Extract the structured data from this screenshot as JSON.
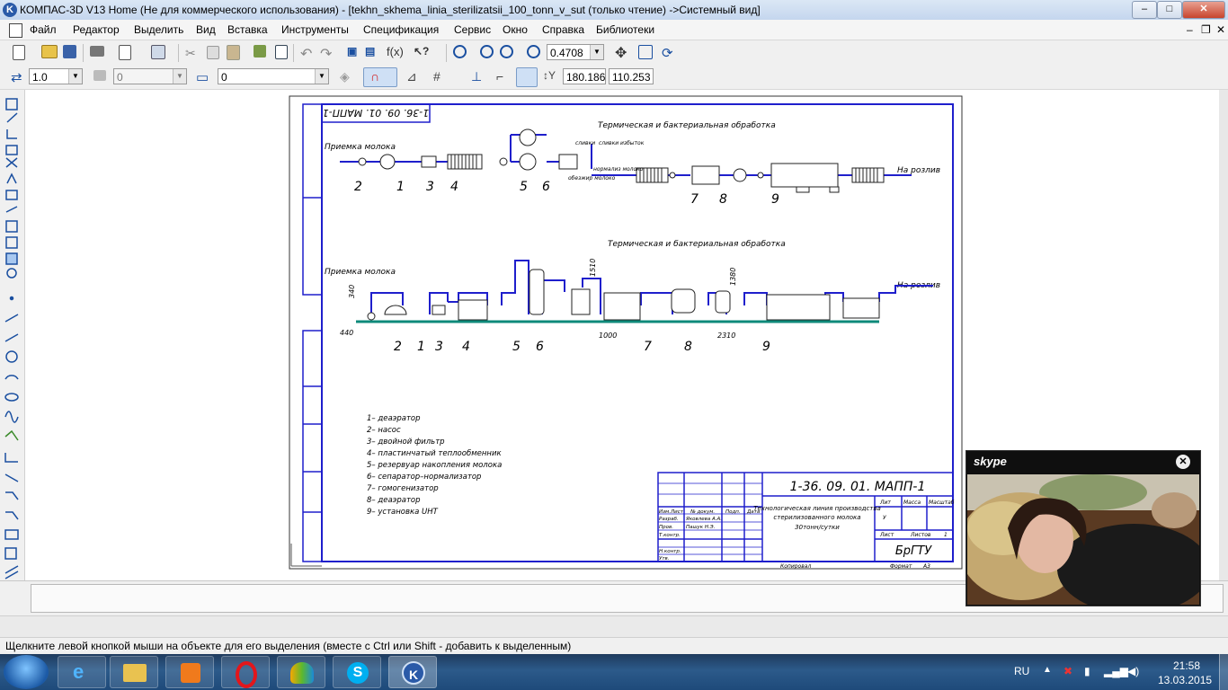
{
  "window": {
    "title": "КОМПАС-3D V13 Home (Не для коммерческого использования) - [tekhn_skhema_linia_sterilizatsii_100_tonn_v_sut (только чтение) ->Системный вид]",
    "app_icon_letter": "K",
    "minimize_label": "–",
    "maximize_label": "□",
    "close_label": "✕",
    "doc_controls": [
      "–",
      "❐",
      "✕"
    ]
  },
  "menu": [
    "Файл",
    "Редактор",
    "Выделить",
    "Вид",
    "Вставка",
    "Инструменты",
    "Спецификация",
    "Сервис",
    "Окно",
    "Справка",
    "Библиотеки"
  ],
  "toolbar": {
    "zoom_value": "0.4708",
    "step_value": "1.0",
    "layer_value": "0",
    "style_value": "0",
    "coord_x": "180.186",
    "coord_y": "110.253"
  },
  "drawing": {
    "stamp_top": "1-36. 09. 01. МАПП-1",
    "title1": "Термическая и бактериальная обработка",
    "title2": "Термическая и бактериальная обработка",
    "priemka1": "Приемка молока",
    "priemka2": "Приемка молока",
    "razliv1": "На розлив",
    "razliv2": "На розлив",
    "labels_row1": [
      "2",
      "1",
      "3",
      "4",
      "5",
      "6",
      "7",
      "8",
      "9"
    ],
    "labels_row2": [
      "2",
      "1",
      "3",
      "4",
      "5",
      "6",
      "7",
      "8",
      "9"
    ],
    "dims": [
      "340",
      "440",
      "1510",
      "1000",
      "1380",
      "2310"
    ],
    "small_notes": [
      "сливки",
      "сливки избыток",
      "нормализ молоко",
      "обезжир молоко"
    ],
    "legend": [
      "1– деаэратор",
      "2– насос",
      "3– двойной фильтр",
      "4– пластинчатый теплообменник",
      "5– резервуар накопления молока",
      "6– сепаратор–нормализатор",
      "7– гомогенизатор",
      "8– деаэратор",
      "9– установка UHT"
    ],
    "stamp_code": "1-36. 09. 01. МАПП-1",
    "stamp_name_lines": [
      "Технологическая линия производства",
      "стерилизованного молока",
      "30тонн/сутки"
    ],
    "stamp_org": "БрГТУ",
    "stamp_headers": [
      "Лит",
      "Масса",
      "Масштаб"
    ],
    "stamp_lit": "У",
    "stamp_sheet": "Лист",
    "stamp_sheets": "Листов",
    "stamp_sheets_num": "1",
    "stamp_rows": [
      "Изм.",
      "Лист",
      "№ докум.",
      "Подп.",
      "Дата",
      "Разраб.",
      "Пров.",
      "Т.контр.",
      "Н.контр.",
      "Утв."
    ],
    "stamp_persons": [
      "Яковлева А.А.",
      "Пашук Н.Э."
    ],
    "copied": "Копировал",
    "format": "Формат",
    "format_val": "А3"
  },
  "status": {
    "hint": "Щелкните левой кнопкой мыши на объекте для его выделения (вместе с Ctrl или Shift - добавить к выделенным)"
  },
  "taskbar": {
    "lang": "RU",
    "time": "21:58",
    "date": "13.03.2015"
  },
  "skype": {
    "logo": "skype",
    "close": "✕"
  }
}
